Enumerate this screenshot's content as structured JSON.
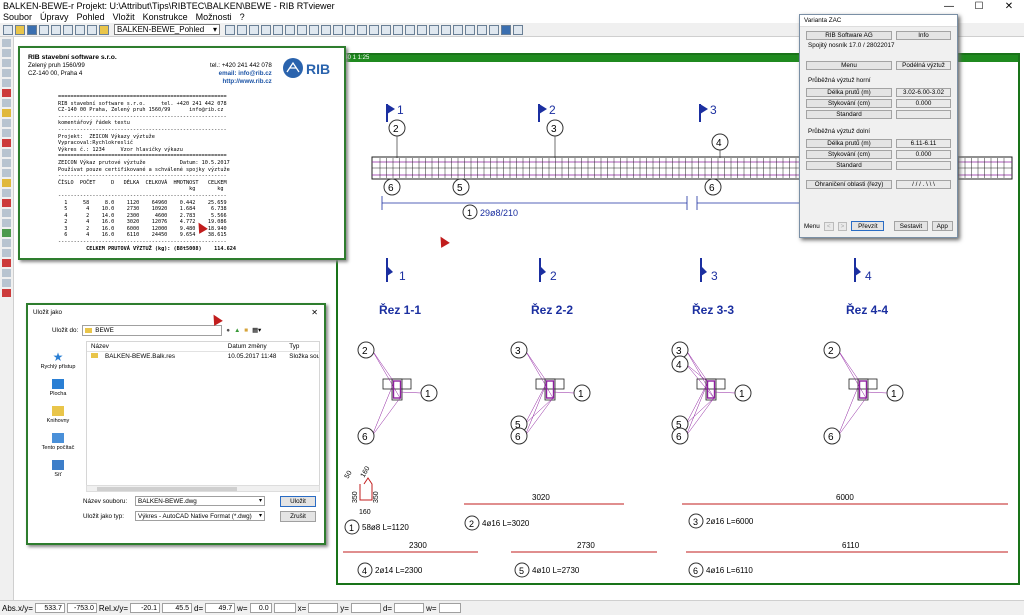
{
  "window": {
    "title": "BALKEN-BEWE-r  Projekt: U:\\Attribut\\Tips\\RIBTEC\\BALKEN\\BEWE  -  RIB RTviewer",
    "minimize": "—",
    "maximize": "☐",
    "close": "✕"
  },
  "menu": [
    "Soubor",
    "Úpravy",
    "Pohled",
    "Vložit",
    "Konstrukce",
    "Možnosti",
    "?"
  ],
  "toolbar": {
    "view_combo": "BALKEN-BEWE_Pohled"
  },
  "drawing": {
    "header": "140 1   1:25",
    "sections_top": [
      "1",
      "2",
      "3"
    ],
    "section_marks": [
      "1",
      "2",
      "3",
      "4"
    ],
    "section_titles": [
      "Řez 1-1",
      "Řez 2-2",
      "Řez 3-3",
      "Řez 4-4"
    ],
    "bar_numbers": [
      "1",
      "2",
      "3",
      "4",
      "5",
      "6"
    ],
    "stirrup_label": "29ø8/210",
    "stirrup_dims": [
      "50",
      "160",
      "350",
      "350",
      "160"
    ],
    "bars": [
      {
        "no": "1",
        "label": "58ø8 L=1120",
        "length": ""
      },
      {
        "no": "2",
        "label": "4ø16 L=3020",
        "length": "3020"
      },
      {
        "no": "3",
        "label": "2ø16 L=6000",
        "length": "6000"
      },
      {
        "no": "4",
        "label": "2ø14 L=2300",
        "length": "2300"
      },
      {
        "no": "5",
        "label": "4ø10 L=2730",
        "length": "2730"
      },
      {
        "no": "6",
        "label": "4ø16 L=6110",
        "length": "6110"
      }
    ],
    "colors": {
      "concrete": "#222222",
      "rebar": "#8e1f9f",
      "dims": "#1b2fa0",
      "baseline": "#c21e1e",
      "frame": "#1f8a1f"
    }
  },
  "doc": {
    "company": "RIB stavební software s.r.o.",
    "addr1": "Zelený pruh 1560/99",
    "addr2": "CZ-140 00, Praha 4",
    "tel": "tel.: +420 241 442 078",
    "email": "email: info@rib.cz",
    "web": "http://www.rib.cz",
    "logo": "RIB",
    "report_lines": [
      "======================================================",
      "RIB stavební software s.r.o.     tel. +420 241 442 078",
      "CZ-140 00 Praha, Zelený pruh 1560/99      info@rib.cz",
      "------------------------------------------------------",
      "komentářový řádek textu",
      "------------------------------------------------------",
      "Projekt:  ZEICON Výkazy výztuže",
      "Vypracoval:Rychlokreslič",
      "Výkres č.: 1234     Vzor hlavičky výkazu",
      "======================================================",
      "ZEICON Výkaz prutové výztuže           Datum: 10.5.2017",
      "Používat pouze certifikované a schválené spojky výztuže",
      "------------------------------------------------------",
      "ČÍSLO  POČET     D   DÉLKA  CELKOVÁ  HMOTNOST   CELKEM",
      "                                          kg       kg",
      "------------------------------------------------------",
      "  1     58     8.0    1120    64960    0.442    25.659",
      "  5      4    10.0    2730    10920    1.684     6.738",
      "  4      2    14.0    2300     4600    2.783     5.566",
      "  2      4    16.0    3020    12076    4.772    19.086",
      "  3      2    16.0    6000    12000    9.480    18.940",
      "  6      4    16.0    6110    24450    9.654    38.615",
      "------------------------------------------------------"
    ],
    "report_total": "         CELKEM PRUTOVÁ VÝZTUŽ (kg): (B8t5008)    114.624"
  },
  "zac": {
    "title": "Varianta ZAC",
    "rib_btn": "RIB Software AG",
    "info_btn": "Info",
    "subtitle": "Spojitý nosník 17.0 / 28022017",
    "menu_btn": "Menu",
    "podelna_btn": "Podélná výztuž",
    "top_label": "Průběžná výztuž horní",
    "bottom_label": "Průběžná výztuž dolní",
    "delka_btn": "Délka prutů (m)",
    "stykovani_btn": "Stykování (cm)",
    "standard_btn": "Standard",
    "top_delka": "3.02-6.00-3.02",
    "top_styk": "0.000",
    "bottom_delka": "6.11-6.11",
    "bottom_styk": "0.000",
    "omezeni_btn": "Ohraničení oblasti (řezy)",
    "omezeni_val": "/ / / . \\ \\ \\",
    "menu_lbl": "Menu",
    "prevzit": "Převzít",
    "sestavit": "Sestavit",
    "app": "App"
  },
  "save": {
    "title": "Uložit jako",
    "save_in_label": "Uložit do:",
    "folder": "BEWE",
    "places": [
      "Rychlý přístup",
      "Plocha",
      "Knihovny",
      "Tento počítač",
      "Síť"
    ],
    "col_name": "Název",
    "col_date": "Datum změny",
    "col_type": "Typ",
    "file_name": "BALKEN-BEWE.Balk.res",
    "file_date": "10.05.2017 11:48",
    "file_type": "Složka sou",
    "fname_label": "Název souboru:",
    "fname_value": "BALKEN-BEWE.dwg",
    "ftype_label": "Uložit jako typ:",
    "ftype_value": "Výkres - AutoCAD Native Format (*.dwg)",
    "save_btn": "Uložit",
    "cancel_btn": "Zrušit"
  },
  "status": {
    "abs_label": "Abs.x/y=",
    "abs_x": "533.7",
    "abs_y": "-753.0",
    "rel_label": "Rel.x/y=",
    "rel_x": "-20.1",
    "rel_y": "45.5",
    "d_label": "d=",
    "d_val": "49.7",
    "w_label": "w=",
    "w_val": "0.0",
    "x_label": "x=",
    "y_label": "y=",
    "d2_label": "d=",
    "w2_label": "w="
  }
}
